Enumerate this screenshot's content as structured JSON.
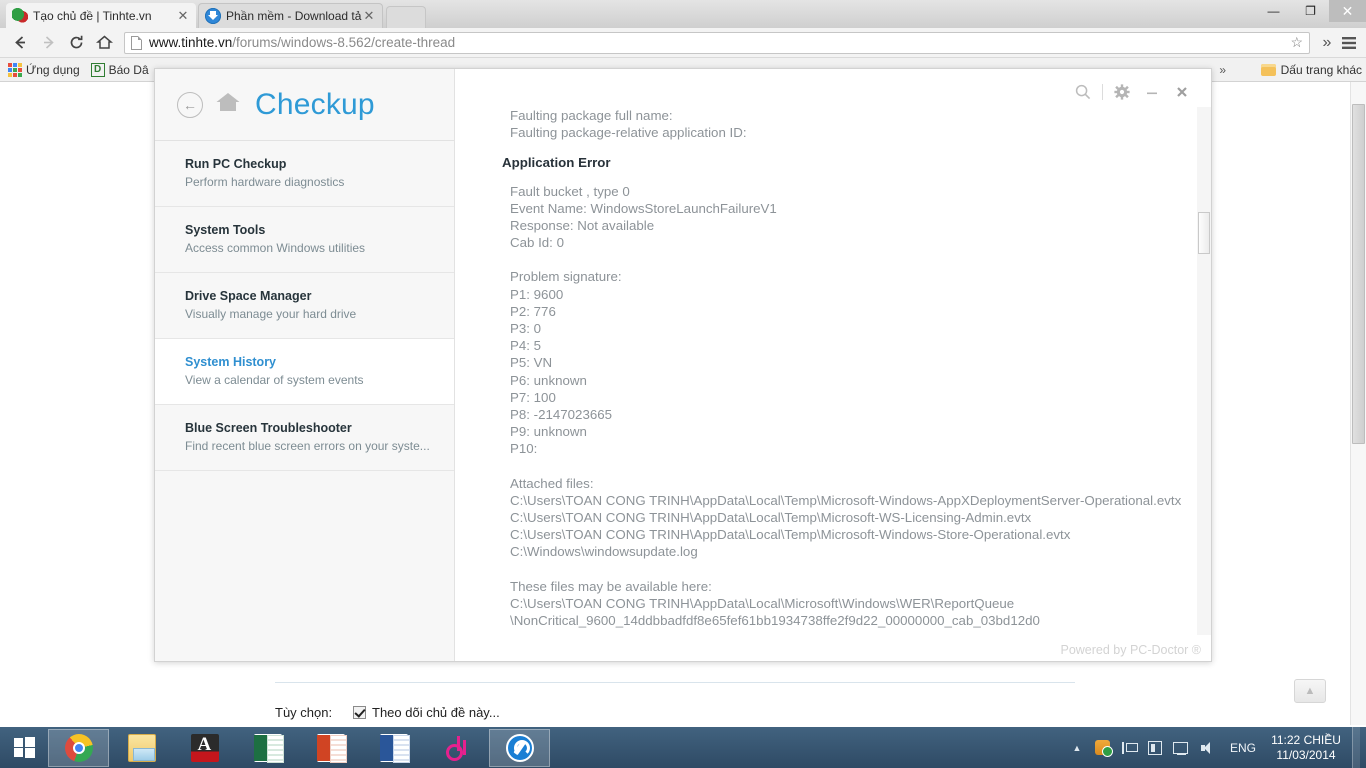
{
  "browser": {
    "tabs": [
      {
        "title": "Tạo chủ đề | Tinhte.vn",
        "favicon": "tinhte-icon",
        "close": "✕",
        "active": true
      },
      {
        "title": "Phần mềm - Download tả",
        "favicon": "download-icon",
        "close": "✕",
        "active": false
      }
    ],
    "window_controls": {
      "minimize": "—",
      "maximize": "❐",
      "close": "✕"
    },
    "toolbar": {
      "back": "←",
      "forward": "→",
      "reload": "⟳",
      "home": "⌂",
      "url_host": "www.tinhte.vn",
      "url_path": "/forums/windows-8.562/create-thread",
      "star": "☆",
      "overflow": "»",
      "menu": "☰"
    },
    "bookmarks": {
      "apps_label": "Ứng dụng",
      "items": [
        {
          "label": "Báo Dâ"
        }
      ],
      "overflow": "»",
      "other_label": "Dấu trang khác"
    }
  },
  "checkup": {
    "title": "Checkup",
    "back_icon": "←",
    "home_icon": "home-icon",
    "titlebar_buttons": {
      "search": "search-icon",
      "settings": "gear-icon",
      "minimize": "—",
      "close": "✕"
    },
    "sidebar_items": [
      {
        "title": "Run PC Checkup",
        "sub": "Perform hardware diagnostics",
        "active": false
      },
      {
        "title": "System Tools",
        "sub": "Access common Windows utilities",
        "active": false
      },
      {
        "title": "Drive Space Manager",
        "sub": "Visually manage your hard drive",
        "active": false
      },
      {
        "title": "System History",
        "sub": "View a calendar of system events",
        "active": true
      },
      {
        "title": "Blue Screen Troubleshooter",
        "sub": "Find recent blue screen errors on your syste...",
        "active": false
      }
    ],
    "report": {
      "top_lines": [
        "Faulting package full name:",
        "Faulting package-relative application ID:"
      ],
      "heading": "Application Error",
      "error_lines": [
        "Fault bucket , type 0",
        "Event Name: WindowsStoreLaunchFailureV1",
        "Response: Not available",
        "Cab Id: 0"
      ],
      "signature_header": "Problem signature:",
      "signature_lines": [
        "P1: 9600",
        "P2: 776",
        "P3: 0",
        "P4: 5",
        "P5: VN",
        "P6: unknown",
        "P7: 100",
        "P8: -2147023665",
        "P9: unknown",
        "P10:"
      ],
      "attached_header": "Attached files:",
      "attached_lines": [
        "C:\\Users\\TOAN CONG TRINH\\AppData\\Local\\Temp\\Microsoft-Windows-AppXDeploymentServer-Operational.evtx",
        "C:\\Users\\TOAN CONG TRINH\\AppData\\Local\\Temp\\Microsoft-WS-Licensing-Admin.evtx",
        "C:\\Users\\TOAN CONG TRINH\\AppData\\Local\\Temp\\Microsoft-Windows-Store-Operational.evtx",
        "C:\\Windows\\windowsupdate.log"
      ],
      "available_header": "These files may be available here:",
      "available_lines": [
        "C:\\Users\\TOAN CONG TRINH\\AppData\\Local\\Microsoft\\Windows\\WER\\ReportQueue",
        "\\NonCritical_9600_14ddbbadfdf8e65fef61bb1934738ffe2f9d22_00000000_cab_03bd12d0"
      ]
    },
    "footer": "Powered by PC-Doctor ®",
    "accent_color": "#2f9ad6"
  },
  "page": {
    "options_label": "Tùy chọn:",
    "option1": "Theo dõi chủ đề này...",
    "scroll_top_icon": "▲"
  },
  "taskbar": {
    "start_icon": "windows-logo-icon",
    "items": [
      {
        "name": "chrome",
        "running": true
      },
      {
        "name": "file-explorer",
        "running": false
      },
      {
        "name": "acrobat",
        "running": false
      },
      {
        "name": "excel",
        "running": false
      },
      {
        "name": "powerpoint",
        "running": false
      },
      {
        "name": "word",
        "running": false
      },
      {
        "name": "music-player",
        "running": false
      },
      {
        "name": "pc-doctor",
        "running": true
      }
    ],
    "tray": {
      "show_hidden": "▲",
      "icons": [
        "security-shield-icon",
        "flag-icon",
        "device-icon",
        "network-icon",
        "volume-icon"
      ],
      "language": "ENG",
      "time": "11:22 CHIỀU",
      "date": "11/03/2014"
    }
  }
}
